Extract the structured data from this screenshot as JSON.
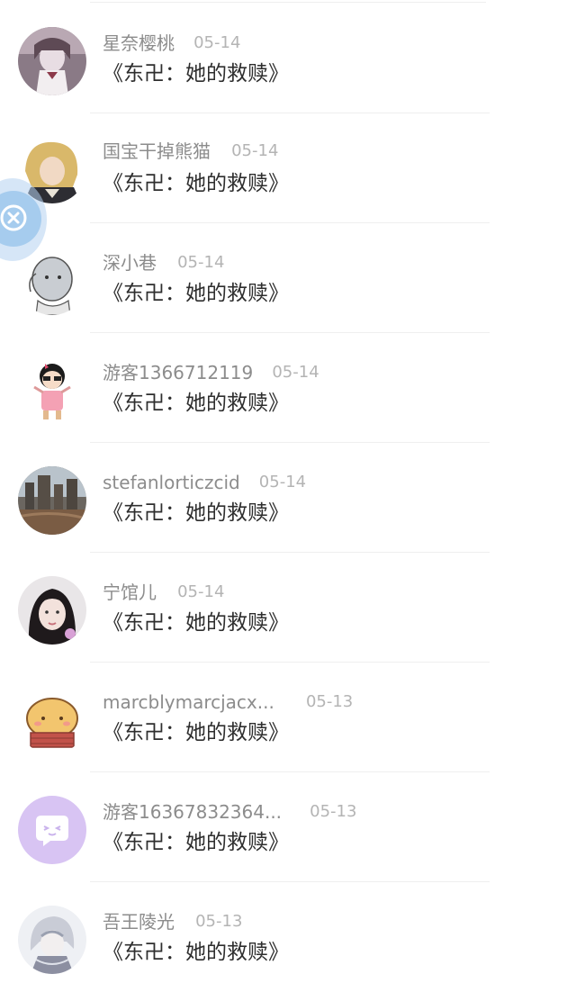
{
  "comments": [
    {
      "username": "星奈樱桃",
      "date": "05-14",
      "title": "《东卍：她的救赎》",
      "avatar": "anime-girl-avatar"
    },
    {
      "username": "国宝干掉熊猫",
      "date": "05-14",
      "title": "《东卍：她的救赎》",
      "avatar": "blonde-character-avatar"
    },
    {
      "username": "深小巷",
      "date": "05-14",
      "title": "《东卍：她的救赎》",
      "avatar": "sketch-character-avatar"
    },
    {
      "username": "游客1366712119",
      "date": "05-14",
      "title": "《东卍：她的救赎》",
      "avatar": "cartoon-girl-avatar"
    },
    {
      "username": "stefanlorticzcid",
      "date": "05-14",
      "title": "《东卍：她的救赎》",
      "avatar": "city-photo-avatar"
    },
    {
      "username": "宁馆儿",
      "date": "05-14",
      "title": "《东卍：她的救赎》",
      "avatar": "girl-photo-avatar"
    },
    {
      "username": "marcblymarcjacx...",
      "date": "05-13",
      "title": "《东卍：她的救赎》",
      "avatar": "bread-mascot-avatar"
    },
    {
      "username": "游客16367832364...",
      "date": "05-13",
      "title": "《东卍：她的救赎》",
      "avatar": "default-chat-avatar"
    },
    {
      "username": "吾王陵光",
      "date": "05-13",
      "title": "《东卍：她的救赎》",
      "avatar": "white-hair-character-avatar"
    }
  ],
  "floating_button": {
    "icon": "close-x-icon",
    "color": "#96c3eb"
  }
}
